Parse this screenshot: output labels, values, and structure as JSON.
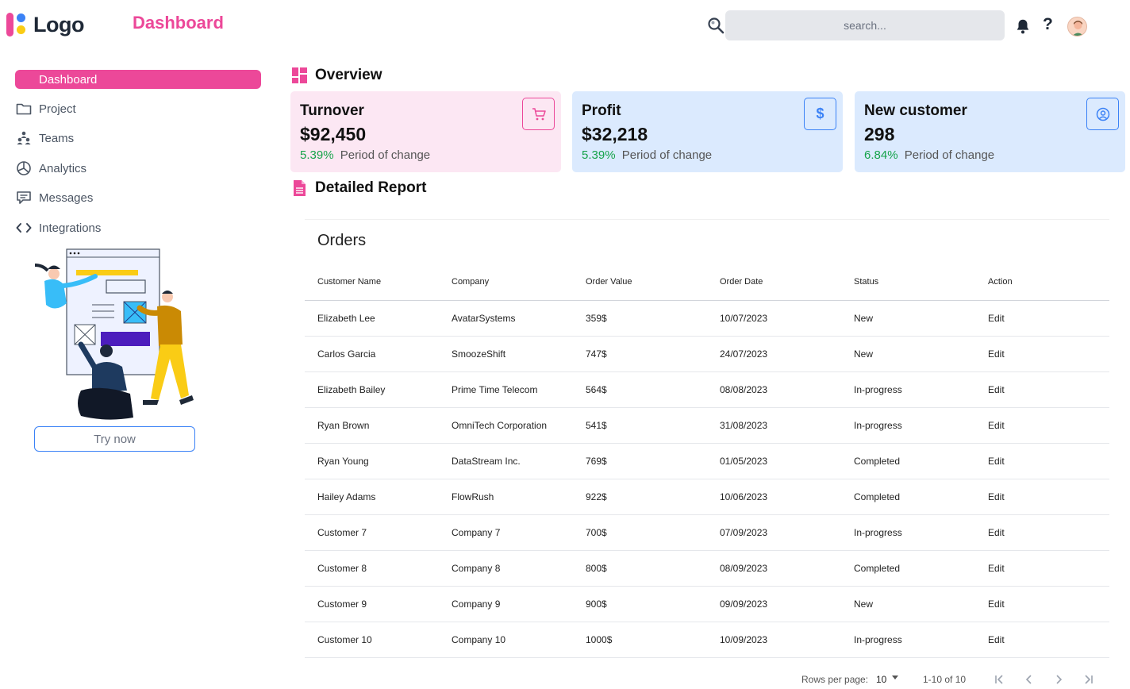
{
  "header": {
    "logo_text": "Logo",
    "page_title": "Dashboard",
    "search_placeholder": "search...",
    "help_label": "?"
  },
  "sidebar": {
    "items": [
      {
        "label": "Dashboard",
        "icon": "dashboard-icon",
        "active": true
      },
      {
        "label": "Project",
        "icon": "folder-icon"
      },
      {
        "label": "Teams",
        "icon": "team-icon"
      },
      {
        "label": "Analytics",
        "icon": "pie-chart-icon"
      },
      {
        "label": "Messages",
        "icon": "message-icon"
      },
      {
        "label": "Integrations",
        "icon": "code-icon"
      }
    ],
    "try_now_label": "Try now"
  },
  "overview": {
    "title": "Overview",
    "cards": [
      {
        "title": "Turnover",
        "value": "$92,450",
        "change_pct": "5.39%",
        "change_label": "Period of change",
        "icon": "cart-icon"
      },
      {
        "title": "Profit",
        "value": "$32,218",
        "change_pct": "5.39%",
        "change_label": "Period of change",
        "icon": "dollar-icon"
      },
      {
        "title": "New customer",
        "value": "298",
        "change_pct": "6.84%",
        "change_label": "Period of change",
        "icon": "user-circle-icon"
      }
    ]
  },
  "report": {
    "title": "Detailed Report",
    "orders_title": "Orders",
    "columns": [
      "Customer Name",
      "Company",
      "Order Value",
      "Order Date",
      "Status",
      "Action"
    ],
    "rows": [
      [
        "Elizabeth Lee",
        "AvatarSystems",
        "359$",
        "10/07/2023",
        "New",
        "Edit"
      ],
      [
        "Carlos Garcia",
        "SmoozeShift",
        "747$",
        "24/07/2023",
        "New",
        "Edit"
      ],
      [
        "Elizabeth Bailey",
        "Prime Time Telecom",
        "564$",
        "08/08/2023",
        "In-progress",
        "Edit"
      ],
      [
        "Ryan Brown",
        "OmniTech Corporation",
        "541$",
        "31/08/2023",
        "In-progress",
        "Edit"
      ],
      [
        "Ryan Young",
        "DataStream Inc.",
        "769$",
        "01/05/2023",
        "Completed",
        "Edit"
      ],
      [
        "Hailey Adams",
        "FlowRush",
        "922$",
        "10/06/2023",
        "Completed",
        "Edit"
      ],
      [
        "Customer 7",
        "Company 7",
        "700$",
        "07/09/2023",
        "In-progress",
        "Edit"
      ],
      [
        "Customer 8",
        "Company 8",
        "800$",
        "08/09/2023",
        "Completed",
        "Edit"
      ],
      [
        "Customer 9",
        "Company 9",
        "900$",
        "09/09/2023",
        "New",
        "Edit"
      ],
      [
        "Customer 10",
        "Company 10",
        "1000$",
        "10/09/2023",
        "In-progress",
        "Edit"
      ]
    ],
    "pagination": {
      "rows_per_page_label": "Rows per page:",
      "rows_per_page_value": "10",
      "range": "1-10 of 10"
    }
  },
  "colors": {
    "accent_pink": "#ec4899",
    "accent_blue": "#3b82f6",
    "positive": "#16a34a",
    "card_pink_bg": "#fce7f3",
    "card_blue_bg": "#dbeafe"
  }
}
